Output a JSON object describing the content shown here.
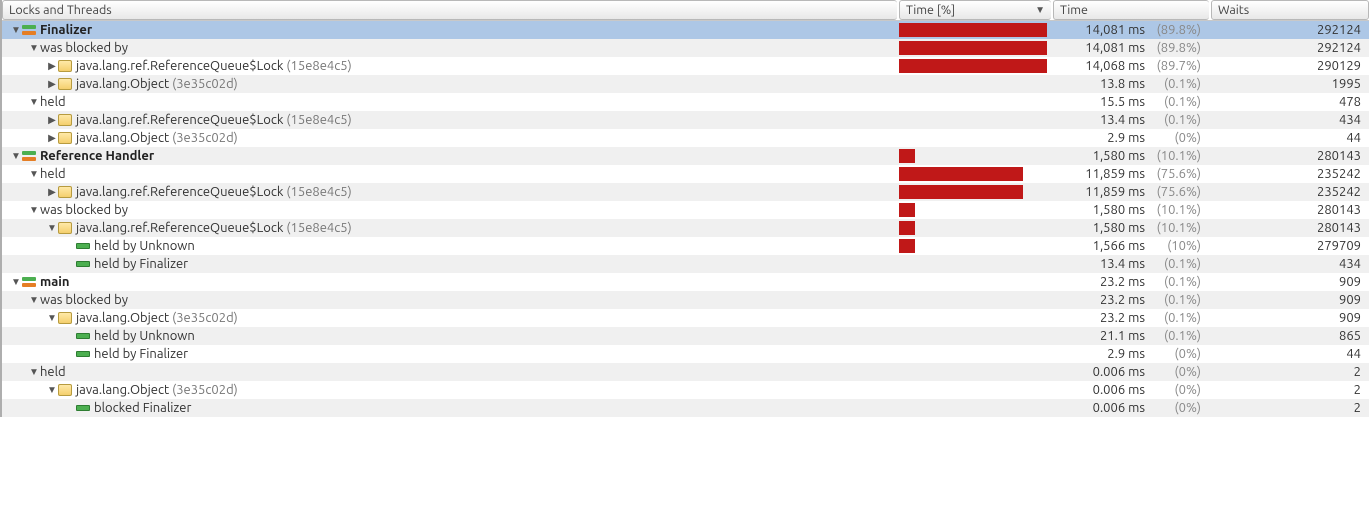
{
  "columns": {
    "name": "Locks and Threads",
    "timepct": "Time [%]",
    "time": "Time",
    "waits": "Waits"
  },
  "sort_column": "timepct",
  "rows": [
    {
      "depth": 0,
      "arrow": "down",
      "icon": "thread",
      "sel": true,
      "bold": true,
      "pre": "",
      "main": "Finalizer",
      "post": "",
      "bar": 100,
      "time": "14,081 ms",
      "pct": "(89.8%)",
      "waits": "292124"
    },
    {
      "depth": 1,
      "arrow": "down",
      "icon": "none",
      "pre": "was blocked by",
      "main": "",
      "post": "",
      "bar": 100,
      "time": "14,081 ms",
      "pct": "(89.8%)",
      "waits": "292124"
    },
    {
      "depth": 2,
      "arrow": "right",
      "icon": "class",
      "pre": "java.lang.ref.",
      "main": "ReferenceQueue$Lock",
      "post": " (15e8e4c5)",
      "bar": 100,
      "time": "14,068 ms",
      "pct": "(89.7%)",
      "waits": "290129"
    },
    {
      "depth": 2,
      "arrow": "right",
      "icon": "class",
      "pre": "java.lang.",
      "main": "Object",
      "post": " (3e35c02d)",
      "bar": 0,
      "time": "13.8 ms",
      "pct": "(0.1%)",
      "waits": "1995"
    },
    {
      "depth": 1,
      "arrow": "down",
      "icon": "none",
      "pre": "held",
      "main": "",
      "post": "",
      "bar": 0,
      "time": "15.5 ms",
      "pct": "(0.1%)",
      "waits": "478"
    },
    {
      "depth": 2,
      "arrow": "right",
      "icon": "class",
      "pre": "java.lang.ref.",
      "main": "ReferenceQueue$Lock",
      "post": " (15e8e4c5)",
      "bar": 0,
      "time": "13.4 ms",
      "pct": "(0.1%)",
      "waits": "434"
    },
    {
      "depth": 2,
      "arrow": "right",
      "icon": "class",
      "pre": "java.lang.",
      "main": "Object",
      "post": " (3e35c02d)",
      "bar": 0,
      "time": "2.9 ms",
      "pct": "(0%)",
      "waits": "44"
    },
    {
      "depth": 0,
      "arrow": "down",
      "icon": "thread",
      "bold": true,
      "pre": "",
      "main": "Reference Handler",
      "post": "",
      "bar": 11,
      "time": "1,580 ms",
      "pct": "(10.1%)",
      "waits": "280143"
    },
    {
      "depth": 1,
      "arrow": "down",
      "icon": "none",
      "pre": "held",
      "main": "",
      "post": "",
      "bar": 84,
      "time": "11,859 ms",
      "pct": "(75.6%)",
      "waits": "235242"
    },
    {
      "depth": 2,
      "arrow": "right",
      "icon": "class",
      "pre": "java.lang.ref.",
      "main": "ReferenceQueue$Lock",
      "post": " (15e8e4c5)",
      "bar": 84,
      "time": "11,859 ms",
      "pct": "(75.6%)",
      "waits": "235242"
    },
    {
      "depth": 1,
      "arrow": "down",
      "icon": "none",
      "pre": "was blocked by",
      "main": "",
      "post": "",
      "bar": 11,
      "time": "1,580 ms",
      "pct": "(10.1%)",
      "waits": "280143"
    },
    {
      "depth": 2,
      "arrow": "down",
      "icon": "class",
      "pre": "java.lang.ref.",
      "main": "ReferenceQueue$Lock",
      "post": " (15e8e4c5)",
      "bar": 11,
      "time": "1,580 ms",
      "pct": "(10.1%)",
      "waits": "280143"
    },
    {
      "depth": 3,
      "arrow": "blank",
      "icon": "held",
      "pre": "held by Unknown",
      "main": "",
      "post": "",
      "bar": 11,
      "time": "1,566 ms",
      "pct": "(10%)",
      "waits": "279709"
    },
    {
      "depth": 3,
      "arrow": "blank",
      "icon": "held",
      "pre": "held by Finalizer",
      "main": "",
      "post": "",
      "bar": 0,
      "time": "13.4 ms",
      "pct": "(0.1%)",
      "waits": "434"
    },
    {
      "depth": 0,
      "arrow": "down",
      "icon": "thread",
      "bold": true,
      "pre": "",
      "main": "main",
      "post": "",
      "bar": 0,
      "time": "23.2 ms",
      "pct": "(0.1%)",
      "waits": "909"
    },
    {
      "depth": 1,
      "arrow": "down",
      "icon": "none",
      "pre": "was blocked by",
      "main": "",
      "post": "",
      "bar": 0,
      "time": "23.2 ms",
      "pct": "(0.1%)",
      "waits": "909"
    },
    {
      "depth": 2,
      "arrow": "down",
      "icon": "class",
      "pre": "java.lang.",
      "main": "Object",
      "post": " (3e35c02d)",
      "bar": 0,
      "time": "23.2 ms",
      "pct": "(0.1%)",
      "waits": "909"
    },
    {
      "depth": 3,
      "arrow": "blank",
      "icon": "held",
      "pre": "held by Unknown",
      "main": "",
      "post": "",
      "bar": 0,
      "time": "21.1 ms",
      "pct": "(0.1%)",
      "waits": "865"
    },
    {
      "depth": 3,
      "arrow": "blank",
      "icon": "held",
      "pre": "held by Finalizer",
      "main": "",
      "post": "",
      "bar": 0,
      "time": "2.9 ms",
      "pct": "(0%)",
      "waits": "44"
    },
    {
      "depth": 1,
      "arrow": "down",
      "icon": "none",
      "pre": "held",
      "main": "",
      "post": "",
      "bar": 0,
      "time": "0.006 ms",
      "pct": "(0%)",
      "waits": "2"
    },
    {
      "depth": 2,
      "arrow": "down",
      "icon": "class",
      "pre": "java.lang.",
      "main": "Object",
      "post": " (3e35c02d)",
      "bar": 0,
      "time": "0.006 ms",
      "pct": "(0%)",
      "waits": "2"
    },
    {
      "depth": 3,
      "arrow": "blank",
      "icon": "held",
      "pre": "blocked Finalizer",
      "main": "",
      "post": "",
      "bar": 0,
      "time": "0.006 ms",
      "pct": "(0%)",
      "waits": "2"
    }
  ]
}
